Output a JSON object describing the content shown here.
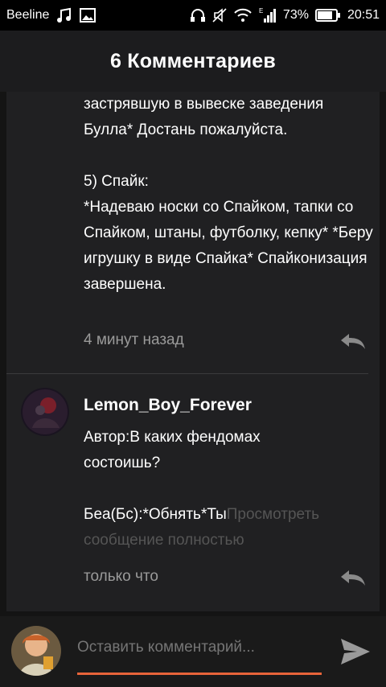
{
  "status": {
    "carrier": "Beeline",
    "battery": "73%",
    "time": "20:51",
    "network_type": "E"
  },
  "header": {
    "title": "6 Комментариев"
  },
  "comment1": {
    "text": "застрявшую в вывеске заведения\nБулла* Достань пожалуйста.\n\n5) Спайк:\n*Надеваю носки со Спайком, тапки со Спайком, штаны, футболку, кепку* *Беру игрушку в виде Спайка* Спайконизация завершена.",
    "time": "4 минут назад"
  },
  "comment2": {
    "username": "Lemon_Boy_Forever",
    "text": "Автор:В каких фендомах\nсостоишь?",
    "truncated_text": "Беа(Бс):*Обнять*Ты",
    "view_full": "Просмотреть сообщение полностью",
    "time": "только что"
  },
  "input": {
    "placeholder": "Оставить комментарий..."
  },
  "colors": {
    "accent": "#e8643a",
    "background": "#141414",
    "panel": "#202022"
  }
}
